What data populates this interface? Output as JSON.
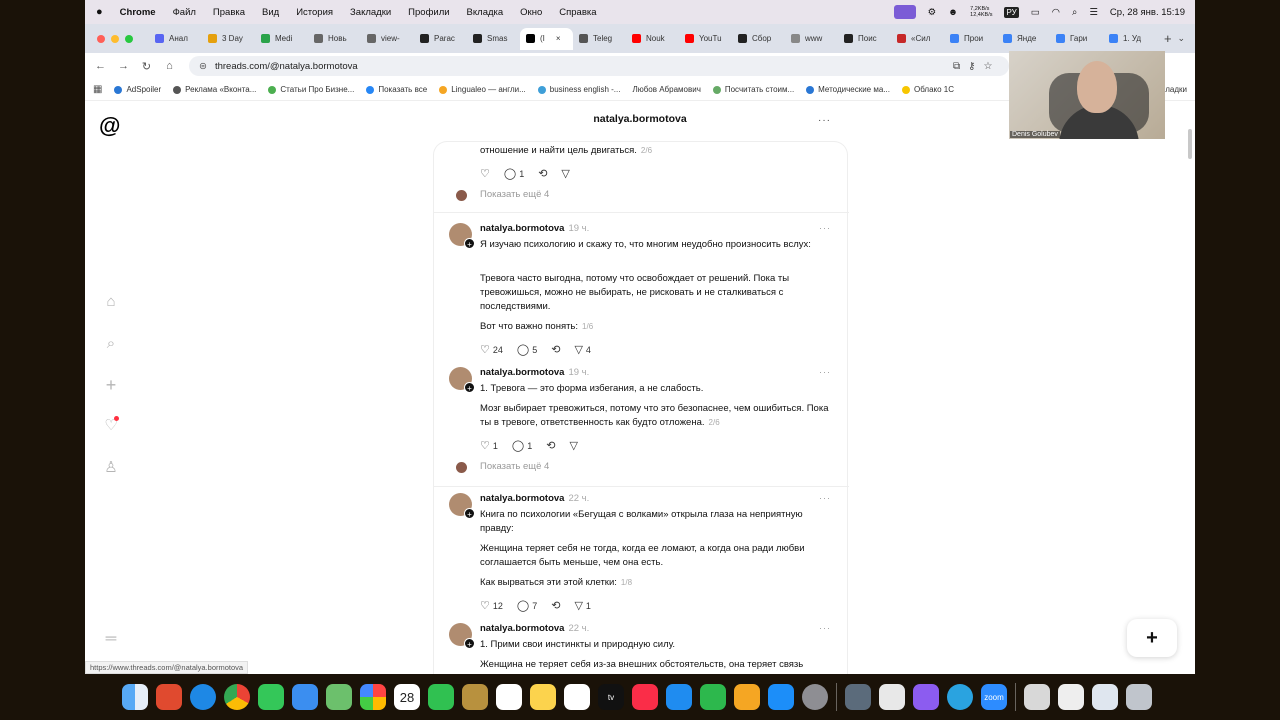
{
  "menubar": {
    "apple": "",
    "items": [
      "Chrome",
      "Файл",
      "Правка",
      "Вид",
      "История",
      "Закладки",
      "Профили",
      "Вкладка",
      "Окно",
      "Справка"
    ],
    "net_speed_up": "7,2KB/s",
    "net_speed_down": "12,4KB/s",
    "keyboard": "РУ",
    "datetime": "Ср, 28 янв.  15:19"
  },
  "tabs": [
    {
      "label": "Анал",
      "color": "#5865f2"
    },
    {
      "label": "3 Day",
      "color": "#e5a00d"
    },
    {
      "label": "Medi",
      "color": "#2aa34a"
    },
    {
      "label": "Новь",
      "color": "#666666"
    },
    {
      "label": "view-",
      "color": "#666666"
    },
    {
      "label": "Parac",
      "color": "#222222"
    },
    {
      "label": "Smas",
      "color": "#222222"
    },
    {
      "label": "(I",
      "color": "#000000",
      "active": true
    },
    {
      "label": "Teleg",
      "color": "#555555"
    },
    {
      "label": "Nouk",
      "color": "#ff0000"
    },
    {
      "label": "YouTu",
      "color": "#ff0000"
    },
    {
      "label": "Сбор",
      "color": "#222222"
    },
    {
      "label": "www",
      "color": "#888888"
    },
    {
      "label": "Поис",
      "color": "#222222"
    },
    {
      "label": "«Сил",
      "color": "#c62828"
    },
    {
      "label": "Прои",
      "color": "#3b82f6"
    },
    {
      "label": "Янде",
      "color": "#3b82f6"
    },
    {
      "label": "Гари",
      "color": "#3b82f6"
    },
    {
      "label": "1. Уд",
      "color": "#3b82f6"
    }
  ],
  "address": {
    "url": "threads.com/@natalya.bormotova"
  },
  "bookmarks": [
    "AdSpoiler",
    "Реклама «Вконта...",
    "Статьи Про Бизне...",
    "Показать все",
    "Lingualeo — англи...",
    "business english -...",
    "Любов Абрамович",
    "Посчитать стоим...",
    "Методические ма...",
    "Облако 1С",
    "лладки"
  ],
  "page": {
    "header_title": "natalya.bormotova",
    "header_more": "···",
    "fab_label": "+",
    "status_url": "https://www.threads.com/@natalya.bormotova"
  },
  "posts": {
    "top_partial": {
      "text": "отношение и найти цель двигаться.",
      "pager": "2/6",
      "replies": "1",
      "show_more": "Показать ещё 4"
    },
    "p1": {
      "username": "natalya.bormotova",
      "time": "19 ч.",
      "para1": "Я изучаю психологию и скажу то, что многим неудобно произносить вслух:",
      "para2": "Тревога часто выгодна, потому что освобождает от решений. Пока ты тревожишься, можно не выбирать, не рисковать и не сталкиваться с последствиями.",
      "para3": "Вот что важно понять:",
      "pager": "1/6",
      "likes": "24",
      "replies": "5",
      "shares": "4"
    },
    "p2": {
      "username": "natalya.bormotova",
      "time": "19 ч.",
      "para1": "1. Тревога — это форма избегания, а не слабость.",
      "para2": "Мозг выбирает тревожиться, потому что это безопаснее, чем ошибиться. Пока ты в тревоге, ответственность как будто отложена.",
      "pager": "2/6",
      "likes": "1",
      "replies": "1",
      "show_more": "Показать ещё 4"
    },
    "p3": {
      "username": "natalya.bormotova",
      "time": "22 ч.",
      "para1": "Книга по психологии «Бегущая с волками» открыла глаза на неприятную правду:",
      "para2": "Женщина теряет себя не тогда, когда ее ломают, а когда она ради любви соглашается быть меньше, чем она есть.",
      "para3": "Как вырваться эти этой клетки:",
      "pager": "1/8",
      "likes": "12",
      "replies": "7",
      "shares": "1"
    },
    "p4": {
      "username": "natalya.bormotova",
      "time": "22 ч.",
      "para1": "1. Прими свои инстинкты и природную силу.",
      "para2": "Женщина не теряет себя из-за внешних обстоятельств, она теряет связь"
    }
  },
  "video": {
    "name": "Denis Golubev"
  },
  "dock": {
    "calendar_day": "28",
    "appletv": "tv",
    "zoom": "zoom"
  }
}
